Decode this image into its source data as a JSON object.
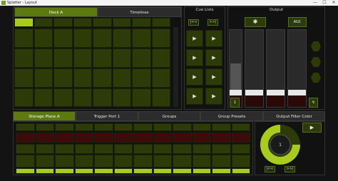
{
  "window": {
    "title": "Splatter - Layout",
    "minimize": "—",
    "maximize": "☐",
    "close": "✕"
  },
  "deck": {
    "tabs": [
      {
        "label": "Deck A"
      },
      {
        "label": "Timelines"
      }
    ]
  },
  "cue": {
    "title": "Cue Lists",
    "prev": "|<<",
    "next": ">>|",
    "play_glyph": "▶"
  },
  "output": {
    "title": "Output",
    "agc": "AGC",
    "fader_button": "1",
    "extra_button": "↯"
  },
  "bottom_tabs": [
    {
      "label": "Storage Place A"
    },
    {
      "label": "Trigger Port 1"
    },
    {
      "label": "Groups"
    },
    {
      "label": "Group Presets"
    },
    {
      "label": "Output Filter Color"
    }
  ],
  "dial": {
    "value": "1",
    "prev": "|<<",
    "next": ">>|",
    "play_glyph": "▶"
  },
  "colors": {
    "accent": "#a7cb1e",
    "cell": "#2d3b08",
    "red_row": "#3d0b0b",
    "active_tab": "#5d7a12"
  },
  "icons": [
    "app-icon",
    "aperture-icon",
    "play-icon",
    "hexagon-icon"
  ]
}
